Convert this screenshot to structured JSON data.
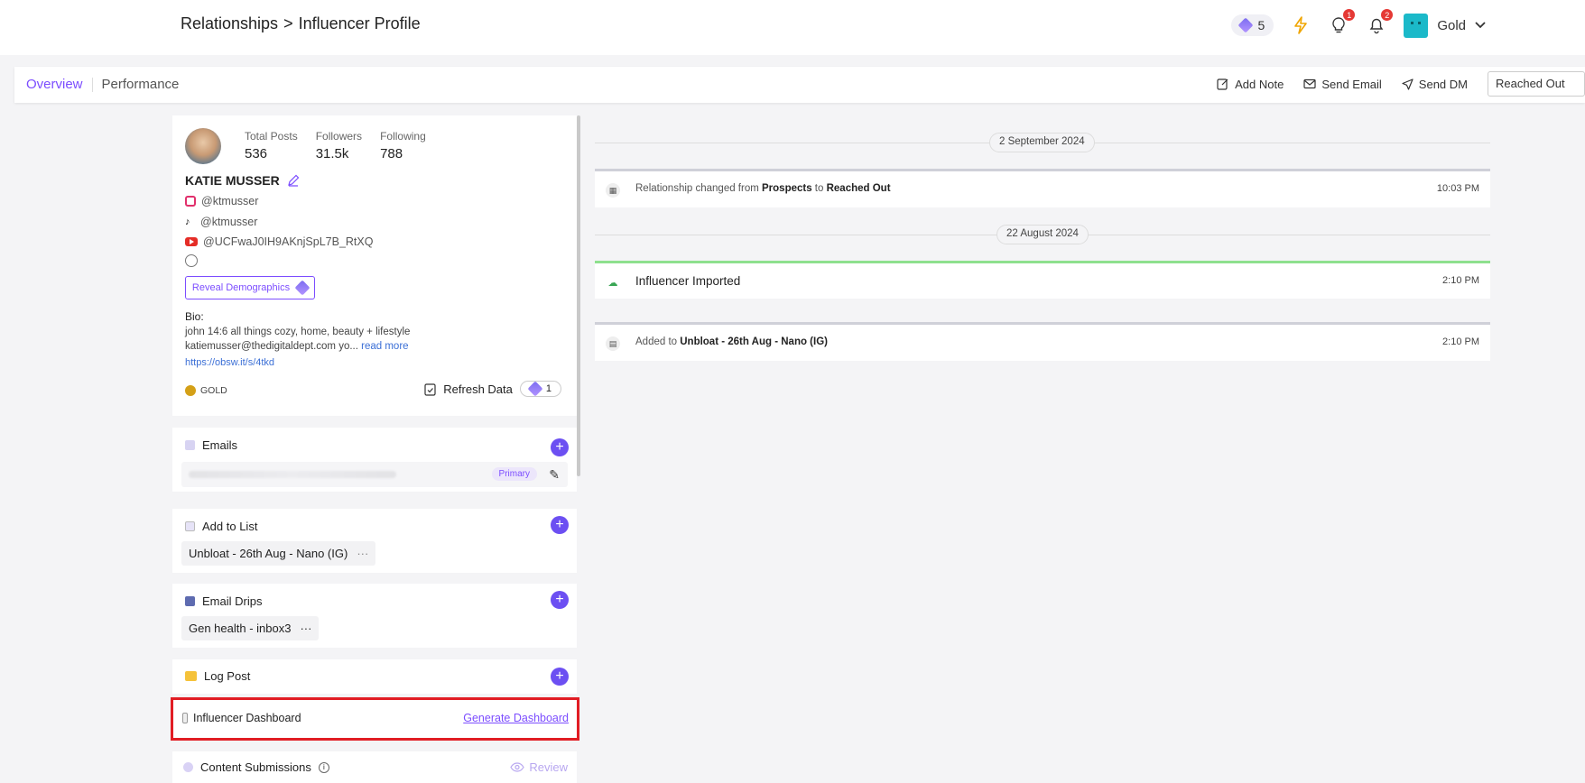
{
  "header": {
    "breadcrumb_root": "Relationships",
    "breadcrumb_sep": ">",
    "breadcrumb_current": "Influencer Profile",
    "credits_count": "5",
    "lightbulb_badge": "1",
    "bell_badge": "2",
    "plan_name": "Gold"
  },
  "tabs": {
    "overview": "Overview",
    "performance": "Performance"
  },
  "actions": {
    "add_note": "Add Note",
    "send_email": "Send Email",
    "send_dm": "Send DM",
    "status": "Reached Out"
  },
  "profile": {
    "stats": [
      {
        "label": "Total Posts",
        "value": "536"
      },
      {
        "label": "Followers",
        "value": "31.5k"
      },
      {
        "label": "Following",
        "value": "788"
      }
    ],
    "name": "KATIE MUSSER",
    "instagram": "@ktmusser",
    "tiktok": "@ktmusser",
    "youtube": "@UCFwaJ0IH9AKnjSpL7B_RtXQ",
    "reveal_label": "Reveal Demographics",
    "bio_label": "Bio:",
    "bio_line1": "john 14:6 all things cozy, home, beauty + lifestyle",
    "bio_line2": "katiemusser@thedigitaldept.com yo...",
    "read_more": "read more",
    "bio_link": "https://obsw.it/s/4tkd",
    "tier": "GOLD",
    "refresh_label": "Refresh Data",
    "refresh_cost": "1"
  },
  "sections": {
    "emails_title": "Emails",
    "primary_chip": "Primary",
    "add_to_list_title": "Add to List",
    "list_chip": "Unbloat - 26th Aug - Nano (IG)",
    "email_drips_title": "Email Drips",
    "drip_chip": "Gen health - inbox3",
    "log_post_title": "Log Post",
    "dashboard_title": "Influencer Dashboard",
    "dashboard_link": "Generate Dashboard",
    "content_title": "Content Submissions",
    "review_label": "Review"
  },
  "timeline": {
    "date1": "2 September 2024",
    "event1_prefix": "Relationship changed from ",
    "event1_from": "Prospects",
    "event1_mid": " to ",
    "event1_to": "Reached Out",
    "event1_time": "10:03 PM",
    "date2": "22 August 2024",
    "event2_text": "Influencer Imported",
    "event2_time": "2:10 PM",
    "event3_prefix": "Added to ",
    "event3_target": "Unbloat - 26th Aug - Nano (IG)",
    "event3_time": "2:10 PM"
  }
}
